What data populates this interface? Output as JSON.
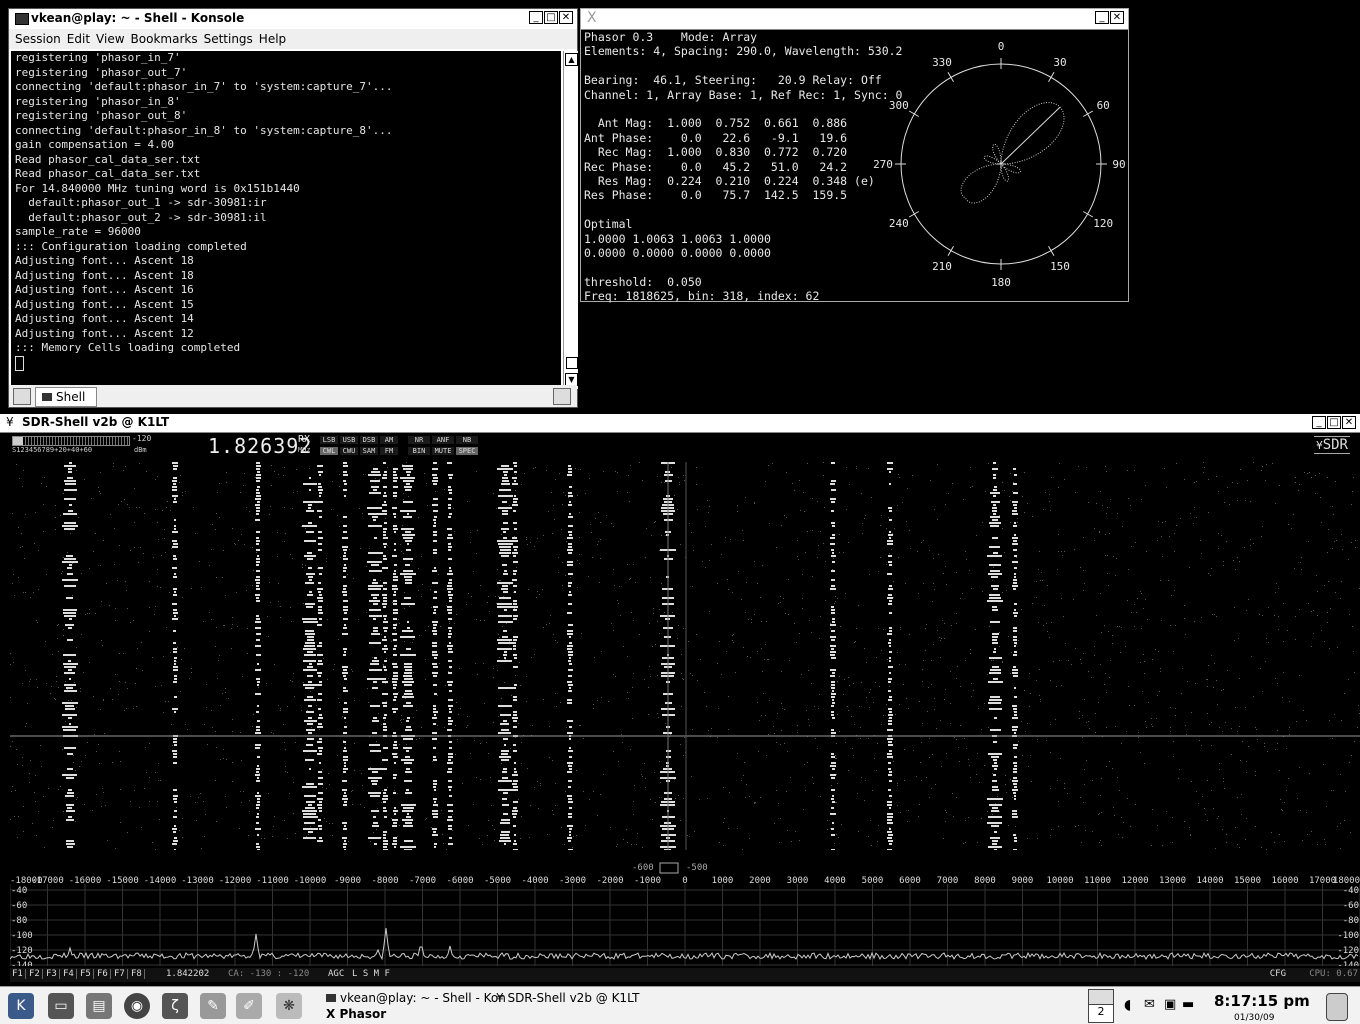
{
  "konsole": {
    "title": "vkean@play: ~ - Shell - Konsole",
    "menu": [
      "Session",
      "Edit",
      "View",
      "Bookmarks",
      "Settings",
      "Help"
    ],
    "lines": [
      "registering 'phasor_in_7'",
      "registering 'phasor_out_7'",
      "connecting 'default:phasor_in_7' to 'system:capture_7'...",
      "registering 'phasor_in_8'",
      "registering 'phasor_out_8'",
      "connecting 'default:phasor_in_8' to 'system:capture_8'...",
      "gain compensation = 4.00",
      "Read phasor_cal_data_ser.txt",
      "Read phasor_cal_data_ser.txt",
      "For 14.840000 MHz tuning word is 0x151b1440",
      "  default:phasor_out_1 -> sdr-30981:ir",
      "  default:phasor_out_2 -> sdr-30981:il",
      "sample_rate = 96000",
      "::: Configuration loading completed",
      "Adjusting font... Ascent 18",
      "Adjusting font... Ascent 18",
      "Adjusting font... Ascent 16",
      "Adjusting font... Ascent 15",
      "Adjusting font... Ascent 14",
      "Adjusting font... Ascent 12",
      "::: Memory Cells loading completed"
    ],
    "tab_label": "Shell"
  },
  "phasor": {
    "title": "",
    "lines": [
      "Phasor 0.3    Mode: Array",
      "Elements: 4, Spacing: 290.0, Wavelength: 530.2",
      "",
      "Bearing:  46.1, Steering:   20.9 Relay: Off",
      "Channel: 1, Array Base: 1, Ref Rec: 1, Sync: 0",
      "",
      "  Ant Mag:  1.000  0.752  0.661  0.886",
      "Ant Phase:    0.0   22.6   -9.1   19.6",
      "  Rec Mag:  1.000  0.830  0.772  0.720",
      "Rec Phase:    0.0   45.2   51.0   24.2",
      "  Res Mag:  0.224  0.210  0.224  0.348 (e)",
      "Res Phase:    0.0   75.7  142.5  159.5",
      "",
      "Optimal",
      "1.0000 1.0063 1.0063 1.0000",
      "0.0000 0.0000 0.0000 0.0000",
      "",
      "threshold:  0.050",
      "Freq: 1818625, bin: 318, index: 62"
    ],
    "polar_labels": {
      "l0": "0",
      "l30": "30",
      "l60": "60",
      "l90": "90",
      "l120": "120",
      "l150": "150",
      "l180": "180",
      "l210": "210",
      "l240": "240",
      "l270": "270",
      "l300": "300",
      "l330": "330"
    }
  },
  "sdr": {
    "title": "SDR-Shell v2b @ K1LT",
    "smeter_scale": "S123456789+20+40+60",
    "smeter_value": "-120",
    "smeter_unit": "dBm",
    "frequency": "1.826392",
    "rx": "RX",
    "mhz": "MHz",
    "modes_top": [
      "LSB",
      "USB",
      "DSB",
      "AM"
    ],
    "modes_bottom": [
      "CWL",
      "CWU",
      "SAM",
      "FM"
    ],
    "flags_top": [
      "NR",
      "ANF",
      "NB"
    ],
    "flags_bottom": [
      "BIN",
      "MUTE",
      "SPEC"
    ],
    "logo": "SDR",
    "filter_lo": "-600",
    "filter_hi": "500",
    "freq_ticks": [
      "-18000",
      "-17000",
      "-16000",
      "-15000",
      "-14000",
      "-13000",
      "-12000",
      "-11000",
      "-10000",
      "-9000",
      "-8000",
      "-7000",
      "-6000",
      "-5000",
      "-4000",
      "-3000",
      "-2000",
      "-1000",
      "0",
      "1000",
      "2000",
      "3000",
      "4000",
      "5000",
      "6000",
      "7000",
      "8000",
      "9000",
      "10000",
      "11000",
      "12000",
      "13000",
      "14000",
      "15000",
      "16000",
      "17000",
      "18000"
    ],
    "db_ticks": [
      "-40",
      "-60",
      "-80",
      "-100",
      "-120",
      "-140"
    ],
    "fkeys": [
      "F1",
      "F2",
      "F3",
      "F4",
      "F5",
      "F6",
      "F7",
      "F8"
    ],
    "tune_freq": "1.842202",
    "ca": "CA: -130 : -120",
    "agc": "AGC",
    "agc_modes": "L S M F",
    "cfg": "CFG",
    "cpu": "CPU: 0.67"
  },
  "taskbar": {
    "task1": "vkean@play: ~ - Shell - Kon",
    "task2": "SDR-Shell v2b @ K1LT",
    "task3": "Phasor",
    "desktop": "2",
    "time": "8:17:15 pm",
    "date": "01/30/09"
  }
}
